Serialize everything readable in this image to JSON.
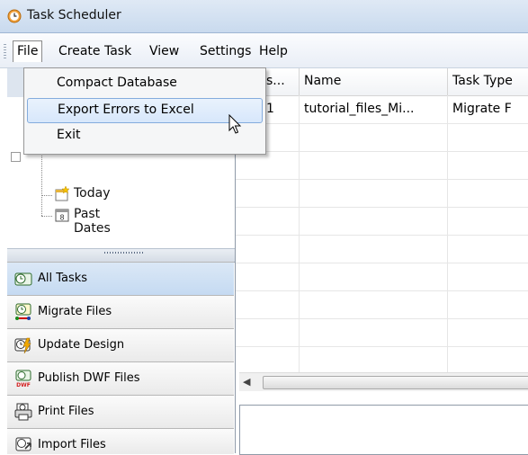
{
  "window": {
    "title": "Task Scheduler"
  },
  "menubar": {
    "items": [
      {
        "label": "File"
      },
      {
        "label": "Create Task"
      },
      {
        "label": "View"
      },
      {
        "label": "Settings"
      },
      {
        "label": "Help"
      }
    ]
  },
  "file_menu": {
    "items": [
      {
        "label": "Compact Database"
      },
      {
        "label": "Export Errors to Excel"
      },
      {
        "label": "Exit"
      }
    ],
    "highlighted_index": 1
  },
  "tree": {
    "nodes": [
      {
        "label": "Today",
        "icon": "calendar-star-icon"
      },
      {
        "label": "Past Dates",
        "icon": "calendar-icon"
      }
    ]
  },
  "nav": {
    "buttons": [
      {
        "label": "All Tasks",
        "icon": "all-tasks-icon",
        "active": true
      },
      {
        "label": "Migrate Files",
        "icon": "migrate-files-icon"
      },
      {
        "label": "Update Design",
        "icon": "update-design-icon"
      },
      {
        "label": "Publish DWF Files",
        "icon": "publish-dwf-icon"
      },
      {
        "label": "Print Files",
        "icon": "print-files-icon"
      },
      {
        "label": "Import Files",
        "icon": "import-files-icon"
      }
    ]
  },
  "grid": {
    "columns": [
      "s...",
      "Name",
      "Task Type"
    ],
    "rows": [
      {
        "id": "1",
        "name": "tutorial_files_Mi...",
        "type": "Migrate F"
      }
    ]
  },
  "colors": {
    "accent": "#c5daf2",
    "menu_highlight": "#d7e7fb"
  }
}
